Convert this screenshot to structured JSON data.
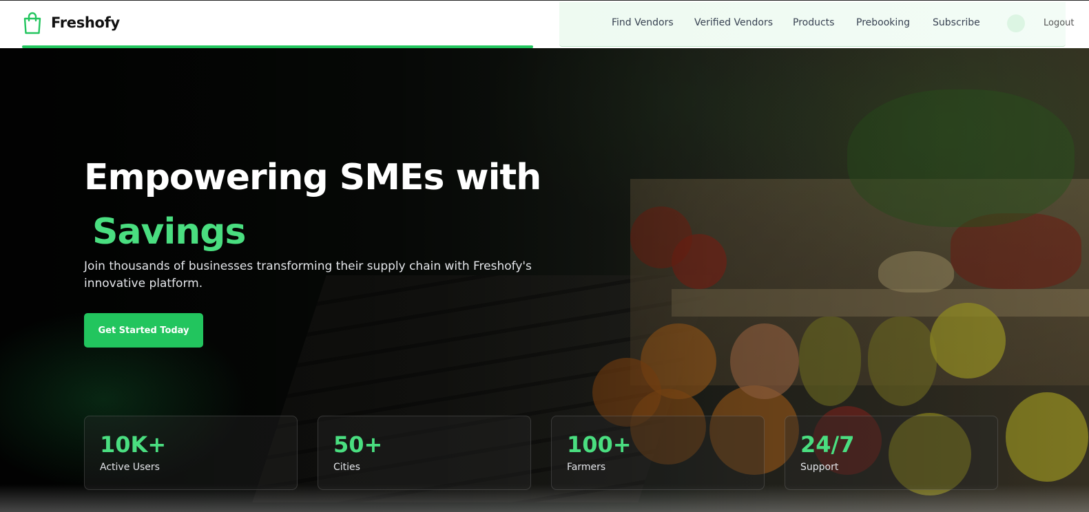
{
  "brand": {
    "name": "Freshofy",
    "accent": "#22c55e",
    "accent_light": "#4ade80"
  },
  "nav": {
    "links": [
      {
        "label": "Find Vendors"
      },
      {
        "label": "Verified Vendors"
      },
      {
        "label": "Products"
      },
      {
        "label": "Prebooking"
      },
      {
        "label": "Subscribe"
      }
    ],
    "logout": "Logout"
  },
  "hero": {
    "title": "Empowering SMEs with",
    "title_accent": "Savings",
    "subtitle": "Join thousands of businesses transforming their supply chain with Freshofy's innovative platform.",
    "cta": "Get Started Today",
    "stats": [
      {
        "value": "10K+",
        "label": "Active Users"
      },
      {
        "value": "50+",
        "label": "Cities"
      },
      {
        "value": "100+",
        "label": "Farmers"
      },
      {
        "value": "24/7",
        "label": "Support"
      }
    ]
  }
}
